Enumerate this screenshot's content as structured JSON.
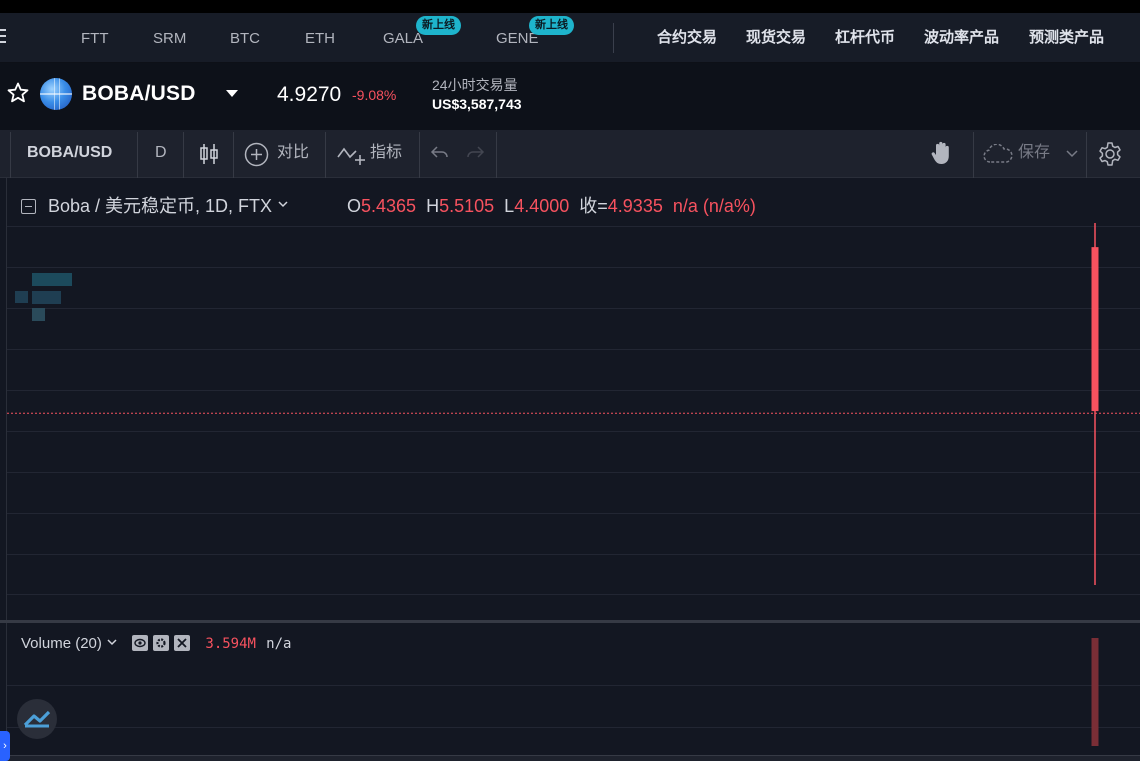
{
  "nav": {
    "coins": [
      {
        "label": "FTT"
      },
      {
        "label": "SRM"
      },
      {
        "label": "BTC"
      },
      {
        "label": "ETH"
      },
      {
        "label": "GALA",
        "badge": "新上线"
      },
      {
        "label": "GENE",
        "badge": "新上线"
      }
    ],
    "products": [
      "合约交易",
      "现货交易",
      "杠杆代币",
      "波动率产品",
      "预测类产品"
    ]
  },
  "ticker": {
    "pair": "BOBA/USD",
    "price": "4.9270",
    "change": "-9.08%",
    "volume_label": "24小时交易量",
    "volume_value": "US$3,587,743"
  },
  "toolbar": {
    "symbol": "BOBA/USD",
    "interval": "D",
    "compare_label": "对比",
    "indicators_label": "指标",
    "save_label": "保存"
  },
  "legend": {
    "title": "Boba / 美元稳定币, 1D, FTX",
    "open_label": "O",
    "open": "5.4365",
    "high_label": "H",
    "high": "5.5105",
    "low_label": "L",
    "low": "4.4000",
    "close_label": "收=",
    "close": "4.9335",
    "change": "n/a (n/a%)"
  },
  "volume": {
    "title": "Volume (20)",
    "value": "3.594M",
    "change": "n/a"
  },
  "colors": {
    "bearish": "#f7525f",
    "accent": "#1eb4cc",
    "background": "#131722"
  },
  "chart_data": {
    "type": "candlestick",
    "candles": [
      {
        "open": 5.4365,
        "high": 5.5105,
        "low": 4.4,
        "close": 4.9335,
        "volume": 3594000
      }
    ],
    "ylim": [
      4.4,
      5.5105
    ],
    "last_price": 4.927
  }
}
